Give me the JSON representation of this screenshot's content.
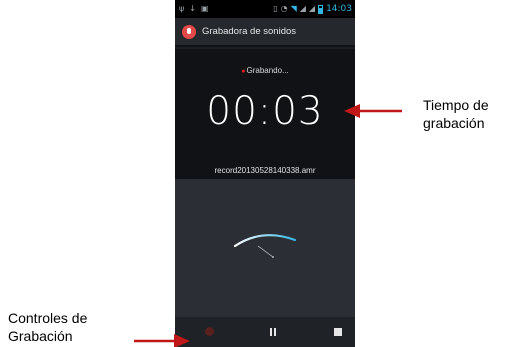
{
  "status_bar": {
    "time": "14:03",
    "icons": [
      "usb-icon",
      "download-icon",
      "image-icon",
      "vibrate-icon",
      "alarm-icon",
      "wifi-icon",
      "signal-icon",
      "signal-icon",
      "battery-icon"
    ]
  },
  "app": {
    "title": "Grabadora de sonidos",
    "icon": "microphone-icon",
    "accent_color": "#33b5e5",
    "record_color": "#e02020"
  },
  "recording": {
    "status": "Grabando...",
    "timer": "00:03",
    "filename": "record20130528140338.amr"
  },
  "controls": {
    "items": [
      "record-icon",
      "pause-icon",
      "stop-icon"
    ]
  },
  "annotations": {
    "time_label": [
      "Tiempo de",
      "grabación"
    ],
    "controls_label": [
      "Controles de",
      "Grabación"
    ]
  }
}
